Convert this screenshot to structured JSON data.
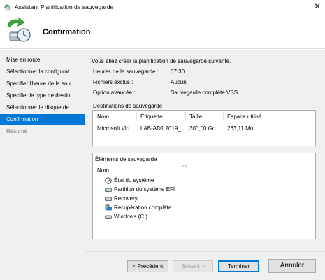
{
  "window": {
    "title": "Assistant Planification de sauvegarde"
  },
  "header": {
    "title": "Confirmation"
  },
  "sidebar": {
    "items": [
      {
        "label": "Mise en route"
      },
      {
        "label": "Sélectionner la configurat..."
      },
      {
        "label": "Spécifier l'heure de la sau..."
      },
      {
        "label": "Spécifier le type de destin..."
      },
      {
        "label": "Sélectionner le disque de ..."
      },
      {
        "label": "Confirmation"
      },
      {
        "label": "Résumé"
      }
    ]
  },
  "main": {
    "intro": "Vous allez créer la planification de sauvegarde suivante.",
    "details": [
      {
        "label": "Heures de la sauvegarde :",
        "value": "07:30"
      },
      {
        "label": "Fichiers exclus :",
        "value": "Aucun"
      },
      {
        "label": "Option avancée :",
        "value": "Sauvegarde complète VSS"
      }
    ],
    "destinations": {
      "title": "Destinations de sauvegarde",
      "columns": [
        "Nom",
        "Étiquette",
        "Taille",
        "Espace utilisé"
      ],
      "rows": [
        [
          "Microsoft Virt...",
          "LAB-AD1 2019_...",
          "300,00 Go",
          "263,11 Mo"
        ]
      ]
    },
    "items": {
      "title": "Éléments de sauvegarde",
      "column": "Nom",
      "list": [
        {
          "label": "État du système",
          "icon": "system-state-icon"
        },
        {
          "label": "Partition du système EFI",
          "icon": "drive-icon"
        },
        {
          "label": "Recovery",
          "icon": "drive-icon"
        },
        {
          "label": "Récupération complète",
          "icon": "bare-metal-icon"
        },
        {
          "label": "Windows (C:)",
          "icon": "drive-icon"
        }
      ]
    }
  },
  "buttons": {
    "previous": "< Précédent",
    "next": "Suivant >",
    "finish": "Terminer",
    "cancel": "Annuler"
  },
  "colors": {
    "accent": "#0078d7",
    "panel": "#f0f0f0"
  }
}
